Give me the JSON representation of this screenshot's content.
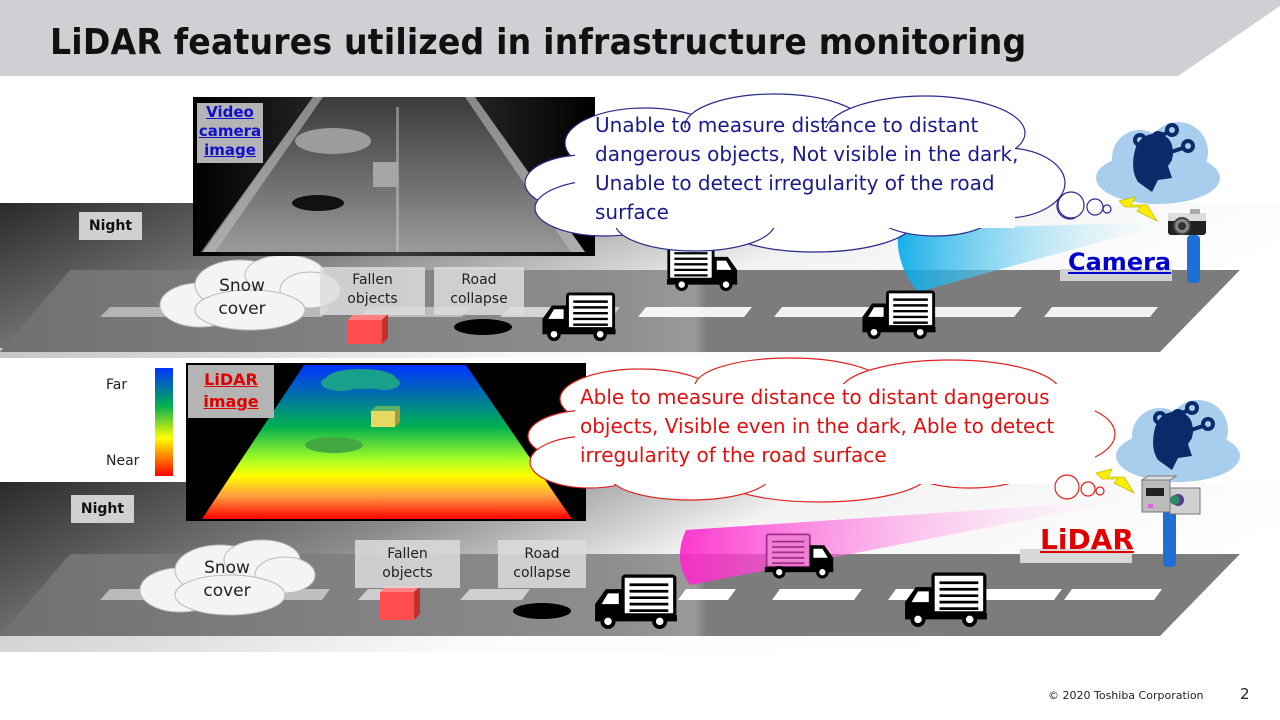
{
  "title": "LiDAR features utilized in infrastructure monitoring",
  "camera_panel": {
    "condition_label": "Night",
    "image_tag": "Video camera image",
    "image_tag_lines": [
      "Video",
      "camera",
      "image"
    ],
    "snow_label_lines": [
      "Snow",
      "cover"
    ],
    "fallen_label_lines": [
      "Fallen",
      "objects"
    ],
    "collapse_label_lines": [
      "Road",
      "collapse"
    ],
    "thought_text": "Unable to measure distance to distant dangerous objects, Not visible in the dark, Unable to detect irregularity of the road surface",
    "thought_lines": [
      "Unable to measure distance to distant",
      "dangerous objects, Not visible in the dark,",
      "Unable to detect irregularity of the road",
      "surface"
    ],
    "sensor_label": "Camera",
    "text_color": "#1a1a8c",
    "sensor_color": "#0000cc",
    "beam_color": "#1ab0ee"
  },
  "lidar_panel": {
    "condition_label": "Night",
    "image_tag_lines": [
      "LiDAR",
      "image"
    ],
    "legend": {
      "far": "Far",
      "near": "Near"
    },
    "snow_label_lines": [
      "Snow",
      "cover"
    ],
    "fallen_label_lines": [
      "Fallen",
      "objects"
    ],
    "collapse_label_lines": [
      "Road",
      "collapse"
    ],
    "thought_text": "Able to measure distance to distant dangerous objects, Visible even in the dark, Able to detect irregularity of the road surface",
    "thought_lines": [
      "Able to measure distance to distant dangerous",
      "objects, Visible even in the dark, Able to detect",
      "irregularity of the road surface"
    ],
    "sensor_label": "LiDAR",
    "text_color": "#e01010",
    "sensor_color": "#e00000",
    "beam_color": "#ff33cc"
  },
  "footer": {
    "copyright": "© 2020 Toshiba Corporation",
    "page_number": "2"
  }
}
